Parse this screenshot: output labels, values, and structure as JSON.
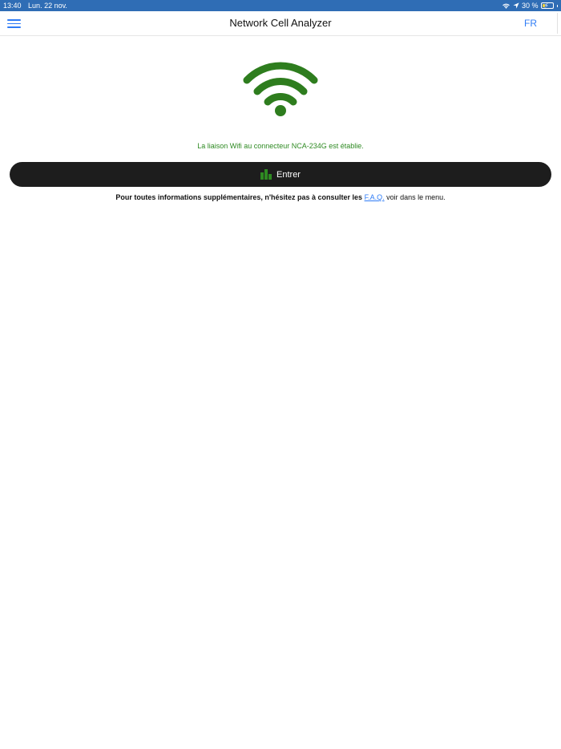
{
  "status_bar": {
    "time": "13:40",
    "date": "Lun. 22 nov.",
    "battery_percent": "30 %",
    "battery_level": 0.3,
    "bg_color": "#2f6db5",
    "icons": [
      "wifi-icon",
      "location-arrow-icon",
      "battery-charging-icon"
    ]
  },
  "nav": {
    "title": "Network Cell Analyzer",
    "language": "FR",
    "menu_icon": "hamburger-menu-icon",
    "accent_color": "#2f7cf6"
  },
  "main": {
    "wifi_icon": "wifi-icon",
    "wifi_color": "#2e7d1e",
    "status_message": "La liaison Wifi au connecteur NCA-234G est établie.",
    "status_color": "#2e8a22",
    "enter_button": {
      "label": "Entrer",
      "icon": "bar-chart-icon",
      "icon_color": "#2e8a22",
      "bg_color": "#1d1d1d"
    },
    "info": {
      "bold_text": "Pour toutes informations supplémentaires, n'hésitez pas à consulter les",
      "link_text": "F.A.Q.",
      "suffix_text": "voir dans le menu."
    }
  }
}
